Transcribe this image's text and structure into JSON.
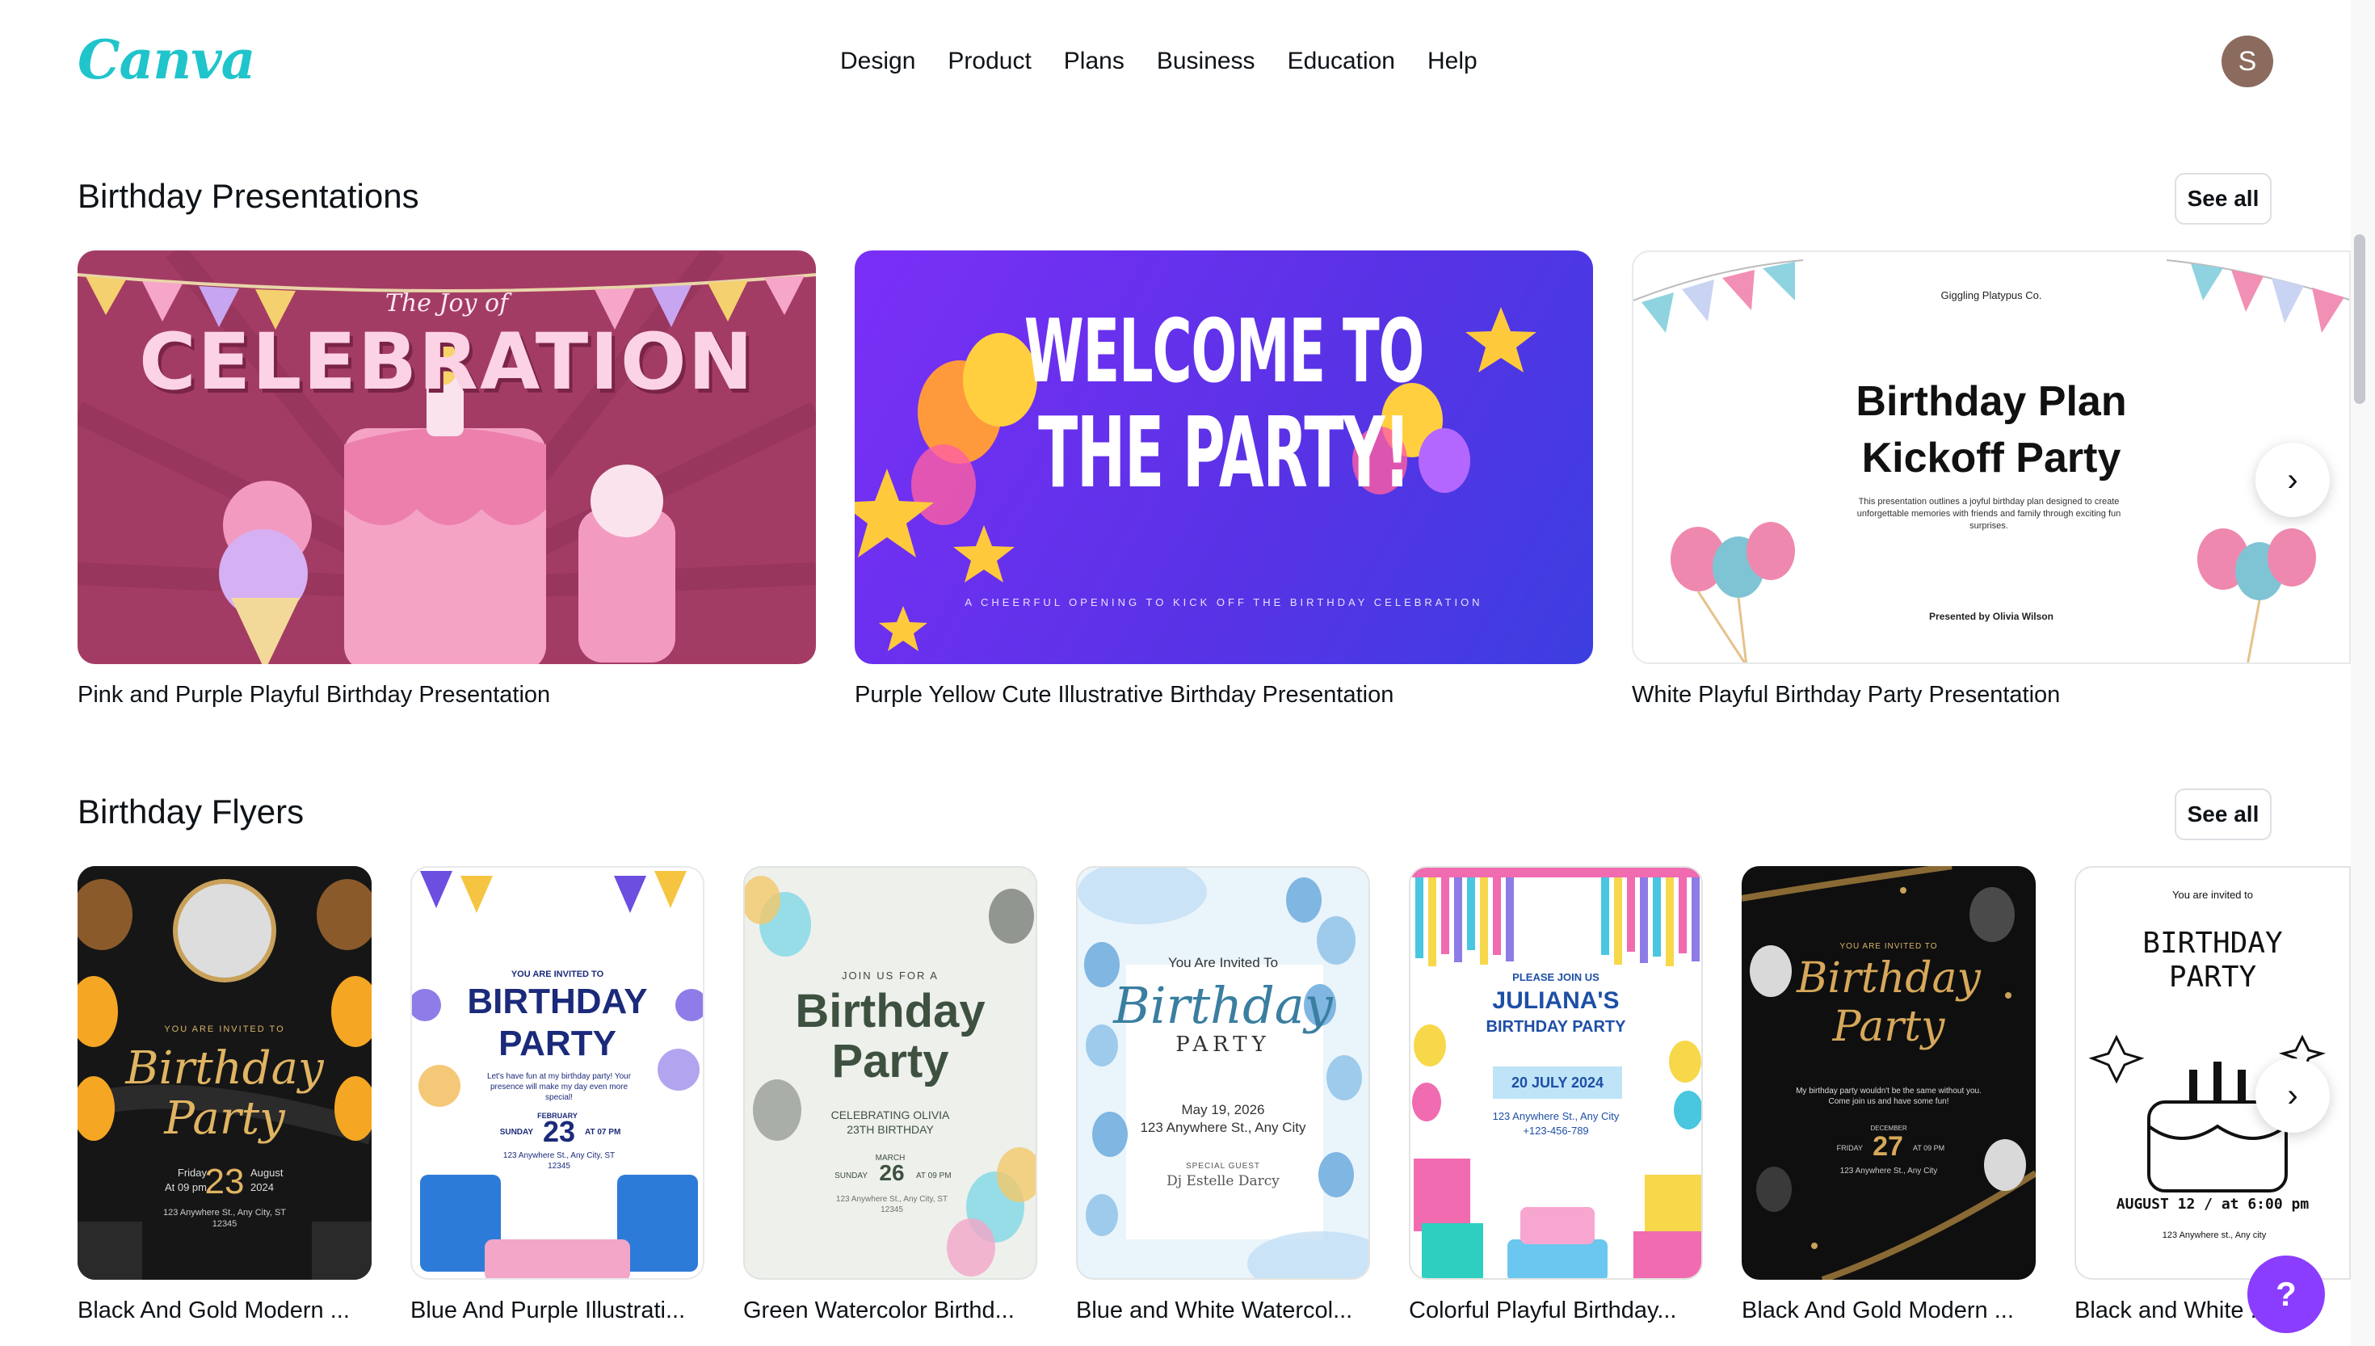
{
  "header": {
    "logo": "Canva",
    "nav": [
      "Design",
      "Product",
      "Plans",
      "Business",
      "Education",
      "Help"
    ],
    "avatar_initial": "S"
  },
  "presentations": {
    "title": "Birthday Presentations",
    "see_all": "See all",
    "cards": [
      {
        "label": "Pink and Purple Playful Birthday Presentation",
        "thumb": {
          "line1": "The Joy of",
          "line2": "CELEBRATION"
        }
      },
      {
        "label": "Purple Yellow Cute Illustrative Birthday Presentation",
        "thumb": {
          "line1": "WELCOME TO",
          "line2": "THE PARTY!",
          "tagline": "A CHEERFUL OPENING TO KICK OFF THE BIRTHDAY CELEBRATION"
        }
      },
      {
        "label": "White Playful Birthday Party Presentation",
        "thumb": {
          "company": "Giggling Platypus Co.",
          "line1": "Birthday Plan",
          "line2": "Kickoff Party",
          "desc": "This presentation outlines a joyful birthday plan designed to create unforgettable memories with friends and family through exciting fun surprises.",
          "presenter": "Presented by Olivia Wilson"
        }
      }
    ]
  },
  "flyers": {
    "title": "Birthday Flyers",
    "see_all": "See all",
    "cards": [
      {
        "label": "Black And Gold Modern ...",
        "thumb": {
          "top": "YOU ARE INVITED TO",
          "script1": "Birthday",
          "script2": "Party",
          "day": "Friday",
          "time": "At 09 pm",
          "date": "23",
          "month": "August",
          "year": "2024",
          "addr": "123 Anywhere St., Any City, ST 12345"
        }
      },
      {
        "label": "Blue And Purple Illustrati...",
        "thumb": {
          "top": "YOU ARE INVITED TO",
          "h1": "BIRTHDAY",
          "h2": "PARTY",
          "body": "Let's have fun at my birthday party! Your presence will make my day even more special!",
          "month": "FEBRUARY",
          "day": "SUNDAY",
          "date": "23",
          "time": "AT 07 PM",
          "addr": "123 Anywhere St., Any City, ST 12345"
        }
      },
      {
        "label": "Green Watercolor Birthd...",
        "thumb": {
          "top": "JOIN US FOR A",
          "h1": "Birthday",
          "h2": "Party",
          "sub1": "CELEBRATING OLIVIA",
          "sub2": "23TH BIRTHDAY",
          "month": "MARCH",
          "day": "SUNDAY",
          "date": "26",
          "time": "AT 09 PM",
          "addr": "123 Anywhere St., Any City, ST 12345"
        }
      },
      {
        "label": "Blue and White Watercol...",
        "thumb": {
          "top": "You Are Invited To",
          "h1": "Birthday",
          "h2": "PARTY",
          "date": "May 19, 2026",
          "addr": "123 Anywhere St., Any City",
          "guest_label": "SPECIAL GUEST",
          "guest": "Dj Estelle Darcy"
        }
      },
      {
        "label": "Colorful Playful Birthday...",
        "thumb": {
          "top": "PLEASE JOIN US",
          "h1": "JULIANA'S",
          "h2": "BIRTHDAY PARTY",
          "date": "20 JULY 2024",
          "addr": "123 Anywhere St., Any City",
          "phone": "+123-456-789"
        }
      },
      {
        "label": "Black And Gold Modern ...",
        "thumb": {
          "top": "YOU ARE INVITED TO",
          "h1": "Birthday",
          "h2": "Party",
          "body": "My birthday party wouldn't be the same without you. Come join us and have some fun!",
          "month": "DECEMBER",
          "day": "FRIDAY",
          "date": "27",
          "time": "AT 09 PM",
          "addr": "123 Anywhere St., Any City"
        }
      },
      {
        "label": "Black and White ...at...",
        "thumb": {
          "top": "You are invited to",
          "h1": "BIRTHDAY",
          "h2": "PARTY",
          "date": "AUGUST 12 / at 6:00 pm",
          "addr": "123 Anywhere st., Any city"
        }
      }
    ]
  },
  "help": "?",
  "colors": {
    "brand_teal": "#20c4cb",
    "brand_purple": "#8b3dff"
  }
}
